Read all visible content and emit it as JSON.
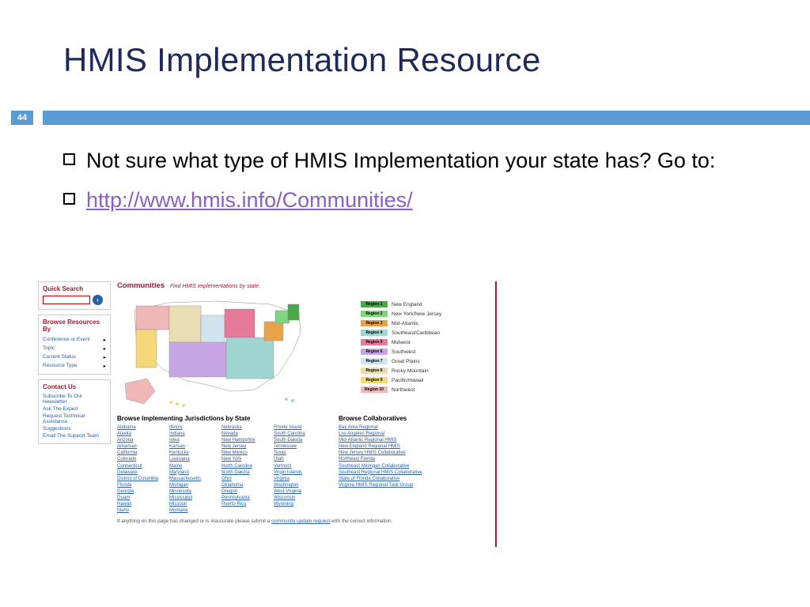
{
  "slide_number": "44",
  "title": "HMIS Implementation Resource",
  "bullets": [
    {
      "text": "Not sure what type of HMIS Implementation your state has?  Go to:"
    },
    {
      "link": "http://www.hmis.info/Communities/"
    }
  ],
  "screenshot": {
    "quick_search": {
      "heading": "Quick Search",
      "placeholder": ""
    },
    "browse_by": {
      "heading": "Browse Resources By",
      "items": [
        "Conference or Event",
        "Topic",
        "Current Status",
        "Resource Type"
      ]
    },
    "contact_us": {
      "heading": "Contact Us",
      "items": [
        "Subscribe To Our Newsletter",
        "Ask The Expert",
        "Request Technical Assistance",
        "Suggestions",
        "Email The Support Team"
      ]
    },
    "communities": {
      "heading": "Communities",
      "sub": "Find HMIS implementations by state."
    },
    "legend": [
      {
        "label": "Region 1",
        "name": "New England",
        "color": "#4aa84a"
      },
      {
        "label": "Region 2",
        "name": "New York/New Jersey",
        "color": "#7fd47f"
      },
      {
        "label": "Region 3",
        "name": "Mid-Atlantic",
        "color": "#e8a34a"
      },
      {
        "label": "Region 4",
        "name": "Southeast/Caribbean",
        "color": "#9fd6d1"
      },
      {
        "label": "Region 5",
        "name": "Midwest",
        "color": "#e77a9a"
      },
      {
        "label": "Region 6",
        "name": "Southwest",
        "color": "#c8a6e5"
      },
      {
        "label": "Region 7",
        "name": "Great Plains",
        "color": "#d0e3ef"
      },
      {
        "label": "Region 8",
        "name": "Rocky Mountain",
        "color": "#e9ddb3"
      },
      {
        "label": "Region 9",
        "name": "Pacific/Hawaii",
        "color": "#f4d77a"
      },
      {
        "label": "Region 10",
        "name": "Northwest",
        "color": "#f1b6b6"
      }
    ],
    "states_heading": "Browse Implementing Jurisdictions by State",
    "states_cols": [
      [
        "Alabama",
        "Alaska",
        "Arizona",
        "Arkansas",
        "California",
        "Colorado",
        "Connecticut",
        "Delaware",
        "District of Columbia",
        "Florida",
        "Georgia",
        "Guam",
        "Hawaii",
        "Idaho"
      ],
      [
        "Illinois",
        "Indiana",
        "Iowa",
        "Kansas",
        "Kentucky",
        "Louisiana",
        "Maine",
        "Maryland",
        "Massachusetts",
        "Michigan",
        "Minnesota",
        "Mississippi",
        "Missouri",
        "Montana"
      ],
      [
        "Nebraska",
        "Nevada",
        "New Hampshire",
        "New Jersey",
        "New Mexico",
        "New York",
        "North Carolina",
        "North Dakota",
        "Ohio",
        "Oklahoma",
        "Oregon",
        "Pennsylvania",
        "Puerto Rico"
      ],
      [
        "Rhode Island",
        "South Carolina",
        "South Dakota",
        "Tennessee",
        "Texas",
        "Utah",
        "Vermont",
        "Virgin Islands",
        "Virginia",
        "Washington",
        "West Virginia",
        "Wisconsin",
        "Wyoming"
      ]
    ],
    "collab_heading": "Browse Collaboratives",
    "collaboratives": [
      "Bay Area Regional",
      "Los Angeles Regional",
      "Mid-Atlantic Regional HMIS",
      "New England Regional HMIS",
      "New Jersey HMIS Collaborative",
      "Northeast Florida",
      "Southeast Michigan Collaborative",
      "Southeast Regional HMIS Collaborative",
      "State of Florida Collaborative",
      "Virginia HMIS Regional Task Group"
    ],
    "footnote_pre": "If anything on this page has changed or is inaccurate please submit a ",
    "footnote_link": "community update request",
    "footnote_post": " with the correct information."
  }
}
